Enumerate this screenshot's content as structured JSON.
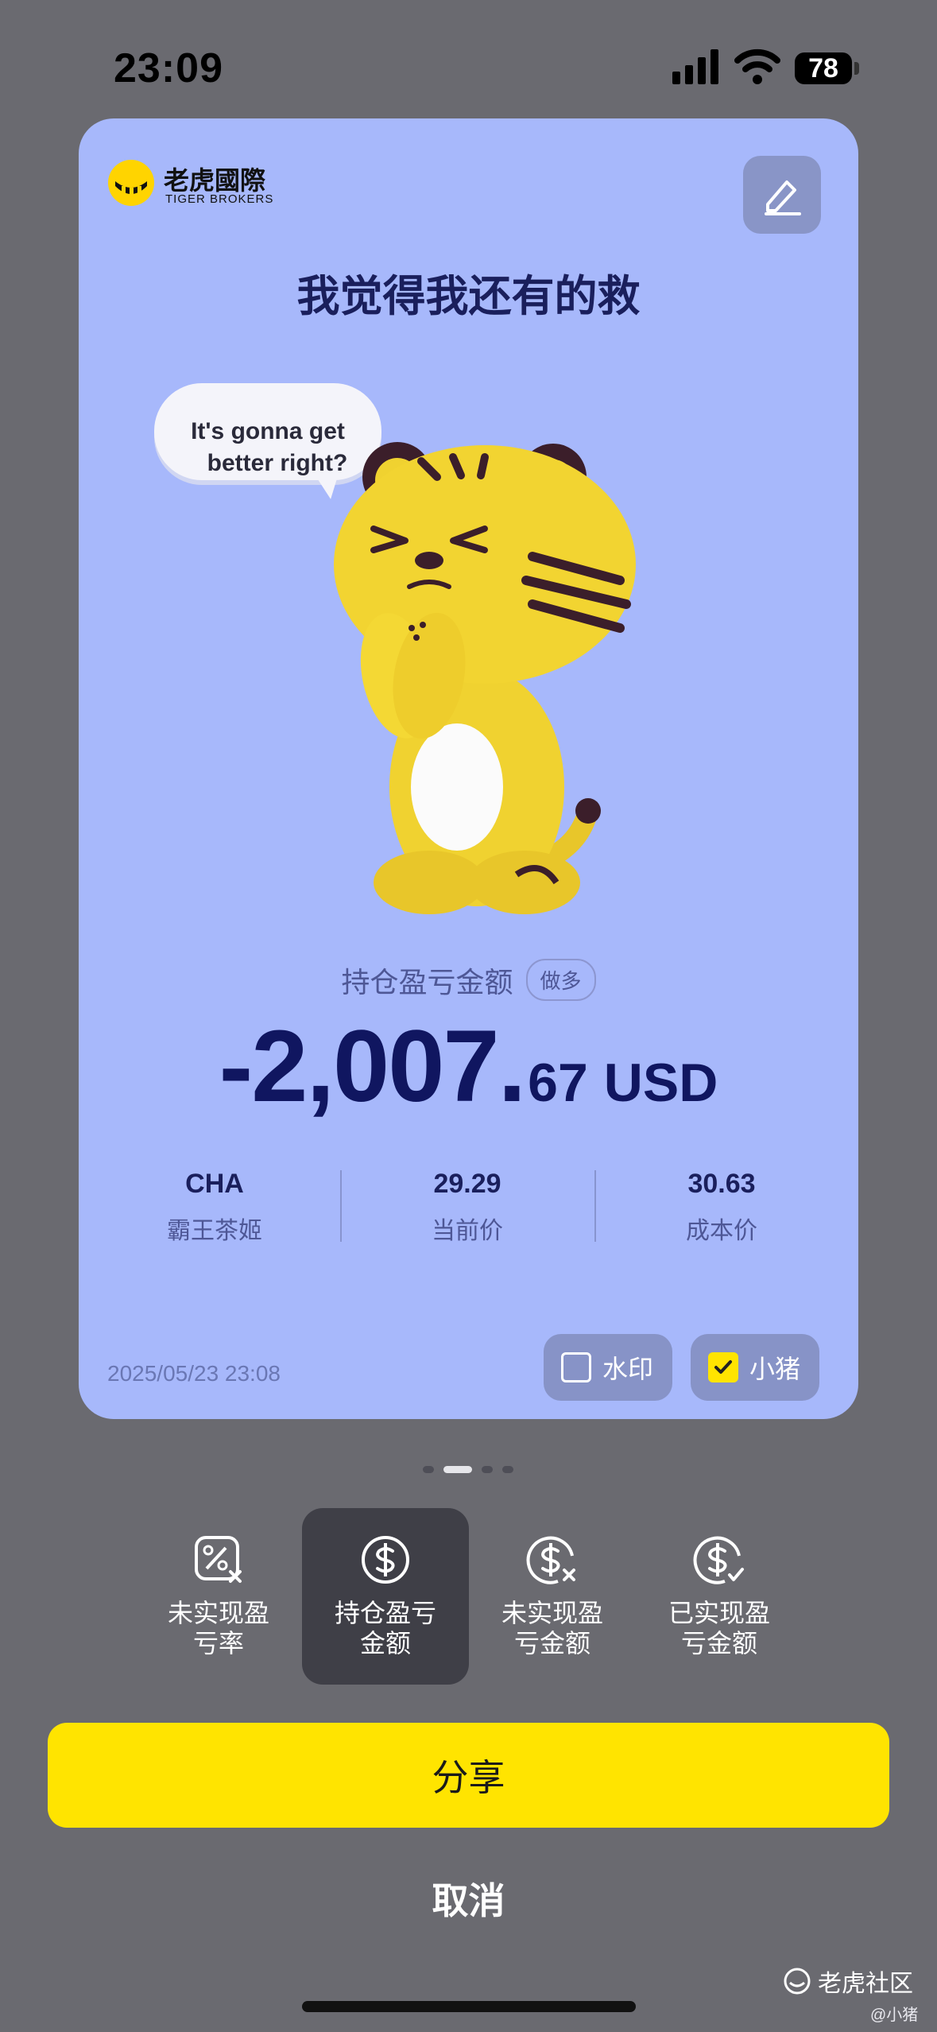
{
  "status_bar": {
    "time": "23:09",
    "battery": "78"
  },
  "card": {
    "brand_cn": "老虎國際",
    "brand_en": "TIGER BROKERS",
    "headline": "我觉得我还有的救",
    "bubble_line1": "It's gonna get",
    "bubble_line2": "better right?",
    "pnl_label": "持仓盈亏金额",
    "pnl_badge": "做多",
    "amount_int": "-2,007.",
    "amount_dec": "67",
    "amount_currency": "USD",
    "stats": [
      {
        "value": "CHA",
        "label": "霸王茶姬"
      },
      {
        "value": "29.29",
        "label": "当前价"
      },
      {
        "value": "30.63",
        "label": "成本价"
      }
    ],
    "date": "2025/05/23 23:08",
    "toggles": [
      {
        "label": "水印",
        "checked": false
      },
      {
        "label": "小猪",
        "checked": true
      }
    ]
  },
  "options": [
    {
      "line1": "未实现盈",
      "line2": "亏率",
      "icon": "percent-x-icon",
      "selected": false
    },
    {
      "line1": "持仓盈亏",
      "line2": "金额",
      "icon": "dollar-circle-icon",
      "selected": true
    },
    {
      "line1": "未实现盈",
      "line2": "亏金额",
      "icon": "dollar-x-icon",
      "selected": false
    },
    {
      "line1": "已实现盈",
      "line2": "亏金额",
      "icon": "dollar-check-icon",
      "selected": false
    }
  ],
  "share_label": "分享",
  "cancel_label": "取消",
  "watermark": {
    "site": "老虎社区",
    "user": "@小猪"
  },
  "colors": {
    "card_bg": "#a7b8fb",
    "accent_yellow": "#ffe400",
    "amount": "#101660"
  }
}
